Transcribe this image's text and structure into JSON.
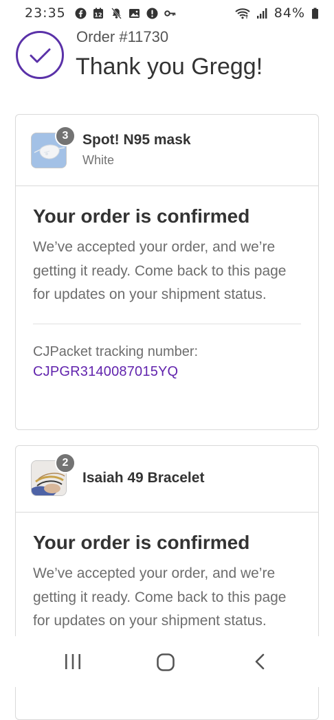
{
  "status_bar": {
    "time": "23:35",
    "battery": "84%",
    "icons": [
      "facebook-icon",
      "calendar-icon",
      "notifications-muted-icon",
      "gallery-icon",
      "alert-icon",
      "vpn-key-icon",
      "wifi-icon",
      "signal-icon",
      "battery-icon"
    ]
  },
  "order": {
    "number": "Order #11730",
    "thank_you": "Thank you Gregg!",
    "accent_color": "#5a31a8",
    "icon": "checkmark-circle-icon"
  },
  "items": [
    {
      "name": "Spot! N95 mask",
      "variant": "White",
      "quantity": "3",
      "image": "n95-mask-thumbnail",
      "status_title": "Your order is confirmed",
      "status_body": "We’ve accepted your order, and we’re getting it ready. Come back to this page for updates on your shipment status.",
      "tracking_label": "CJPacket tracking number:",
      "tracking_number": "CJPGR3140087015YQ"
    },
    {
      "name": "Isaiah 49 Bracelet",
      "variant": "",
      "quantity": "2",
      "image": "bracelet-thumbnail",
      "status_title": "Your order is confirmed",
      "status_body": "We’ve accepted your order, and we’re getting it ready. Come back to this page for updates on your shipment status."
    }
  ],
  "nav": {
    "icons": [
      "recents-icon",
      "home-icon",
      "back-icon"
    ]
  },
  "colors": {
    "link": "#6123ad",
    "badge": "#737373",
    "border": "#d9d9d9"
  }
}
